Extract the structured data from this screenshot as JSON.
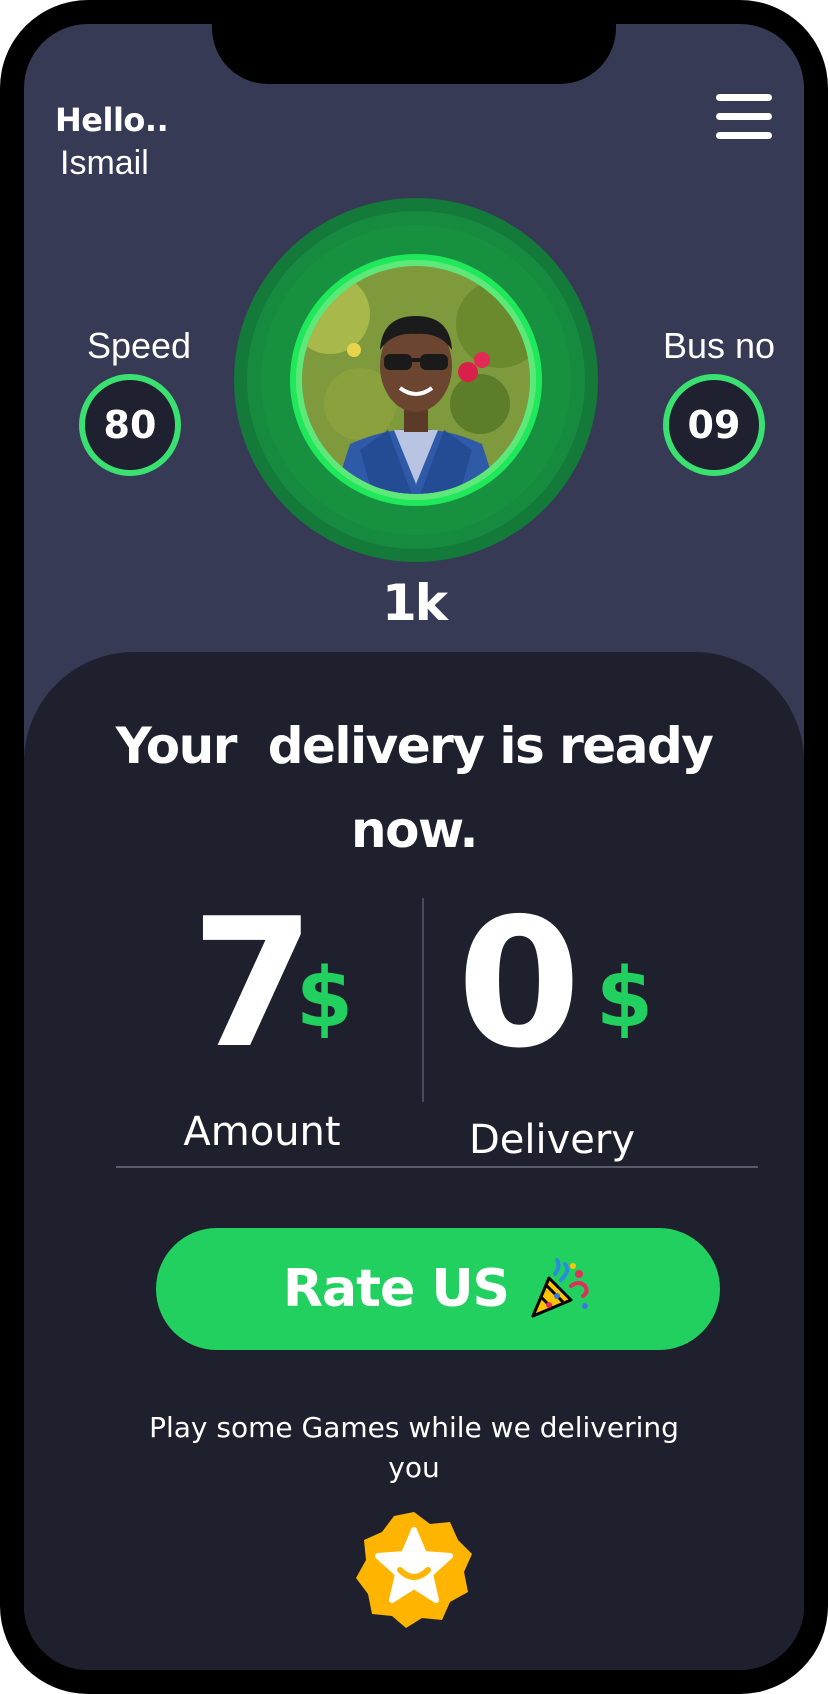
{
  "greeting": {
    "hello": "Hello..",
    "name": "Ismail"
  },
  "stats": {
    "speed_label": "Speed",
    "speed_value": "80",
    "bus_label": "Bus no",
    "bus_value": "09"
  },
  "profile": {
    "points": "1k"
  },
  "delivery": {
    "headline": "Your  delivery is ready now.",
    "amount_value": "7",
    "amount_currency": "$",
    "amount_label": "Amount",
    "delivery_value": "0",
    "delivery_currency": "$",
    "delivery_label": "Delivery"
  },
  "actions": {
    "rate_label": "Rate US"
  },
  "games": {
    "prompt": "Play some Games while we delivering you"
  },
  "icons": {
    "menu": "hamburger-menu-icon",
    "party": "party-popper-icon",
    "games": "star-smile-games-icon"
  },
  "colors": {
    "background_top": "#363a55",
    "panel": "#1f202d",
    "accent_green": "#22d05f",
    "ring_green": "#3ae070",
    "games_icon": "#ffb400"
  }
}
